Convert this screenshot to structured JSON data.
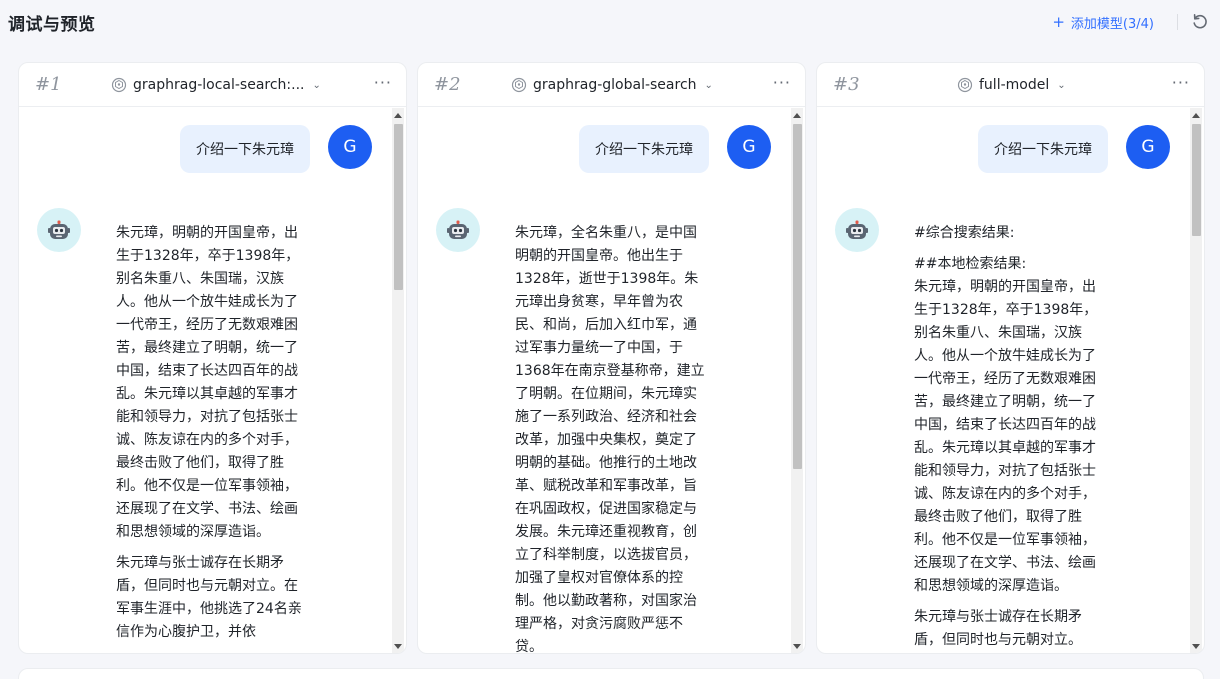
{
  "header": {
    "title": "调试与预览",
    "add_model_label": "添加模型(3/4)"
  },
  "panels": [
    {
      "num": "#1",
      "model": "graphrag-local-search:...",
      "user_message": "介绍一下朱元璋",
      "user_avatar": "G",
      "answer": [
        "朱元璋，明朝的开国皇帝，出生于1328年，卒于1398年，别名朱重八、朱国瑞，汉族人。他从一个放牛娃成长为了一代帝王，经历了无数艰难困苦，最终建立了明朝，统一了中国，结束了长达四百年的战乱。朱元璋以其卓越的军事才能和领导力，对抗了包括张士诚、陈友谅在内的多个对手，最终击败了他们，取得了胜利。他不仅是一位军事领袖，还展现了在文学、书法、绘画和思想领域的深厚造诣。",
        "朱元璋与张士诚存在长期矛盾，但同时也与元朝对立。在军事生涯中，他挑选了24名亲信作为心腹护卫，并依"
      ]
    },
    {
      "num": "#2",
      "model": "graphrag-global-search",
      "user_message": "介绍一下朱元璋",
      "user_avatar": "G",
      "answer": [
        "朱元璋，全名朱重八，是中国明朝的开国皇帝。他出生于1328年，逝世于1398年。朱元璋出身贫寒，早年曾为农民、和尚，后加入红巾军，通过军事力量统一了中国，于1368年在南京登基称帝，建立了明朝。在位期间，朱元璋实施了一系列政治、经济和社会改革，加强中央集权，奠定了明朝的基础。他推行的土地改革、赋税改革和军事改革，旨在巩固政权，促进国家稳定与发展。朱元璋还重视教育，创立了科举制度，以选拔官员，加强了皇权对官僚体系的控制。他以勤政著称，对国家治理严格，对贪污腐败严惩不贷。"
      ]
    },
    {
      "num": "#3",
      "model": "full-model",
      "user_message": "介绍一下朱元璋",
      "user_avatar": "G",
      "answer": [
        "#综合搜索结果:",
        "##本地检索结果:\n朱元璋，明朝的开国皇帝，出生于1328年，卒于1398年，别名朱重八、朱国瑞，汉族人。他从一个放牛娃成长为了一代帝王，经历了无数艰难困苦，最终建立了明朝，统一了中国，结束了长达四百年的战乱。朱元璋以其卓越的军事才能和领导力，对抗了包括张士诚、陈友谅在内的多个对手，最终击败了他们，取得了胜利。他不仅是一位军事领袖，还展现了在文学、书法、绘画和思想领域的深厚造诣。",
        "朱元璋与张士诚存在长期矛盾，但同时也与元朝对立。"
      ]
    }
  ],
  "icons": {
    "model_icon": "cube-icon",
    "more_icon": "ellipsis-icon",
    "refresh_icon": "refresh-icon",
    "bot_avatar": "robot-icon"
  },
  "colors": {
    "accent": "#3370ff",
    "user_avatar_bg": "#1d5ef2",
    "user_bubble_bg": "#e8f1fe",
    "bot_avatar_bg": "#d7f2f6"
  }
}
